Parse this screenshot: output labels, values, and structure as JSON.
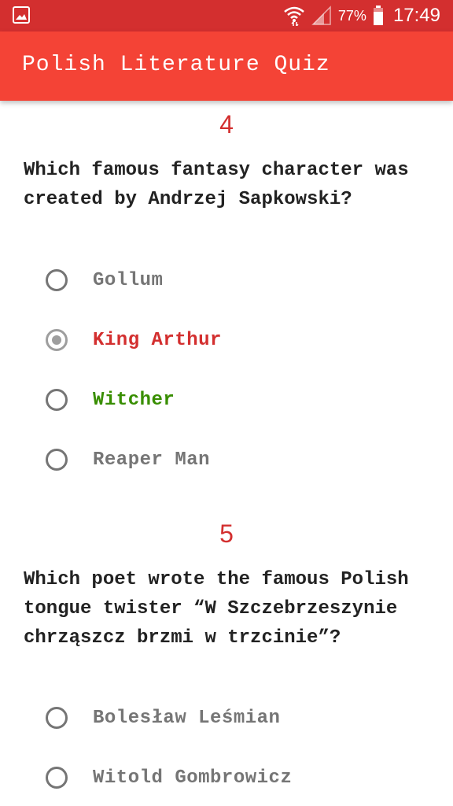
{
  "status_bar": {
    "battery": "77%",
    "time": "17:49"
  },
  "app_bar": {
    "title": "Polish Literature Quiz"
  },
  "questions": [
    {
      "number": "4",
      "text": "Which famous fantasy character was created by Andrzej Sapkowski?",
      "options": [
        {
          "label": "Gollum",
          "state": "default"
        },
        {
          "label": "King Arthur",
          "state": "selected-wrong"
        },
        {
          "label": "Witcher",
          "state": "correct"
        },
        {
          "label": "Reaper Man",
          "state": "default"
        }
      ]
    },
    {
      "number": "5",
      "text": "Which poet wrote the famous Polish tongue twister “W Szczebrzeszynie chrząszcz brzmi w trzcinie”?",
      "options": [
        {
          "label": "Bolesław Leśmian",
          "state": "default"
        },
        {
          "label": "Witold Gombrowicz",
          "state": "default"
        }
      ]
    }
  ],
  "colors": {
    "status_bar": "#d32f2f",
    "app_bar": "#f44336",
    "accent": "#d32f2f",
    "wrong": "#d32f2f",
    "correct": "#388e00",
    "option_text": "#757575"
  }
}
